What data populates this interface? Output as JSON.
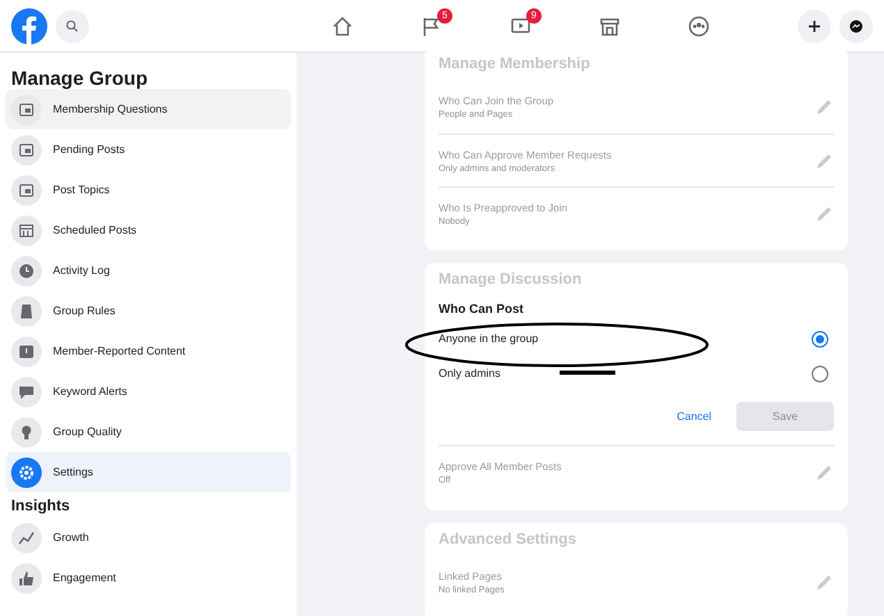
{
  "top_bar": {
    "nav": [
      {
        "kind": "home"
      },
      {
        "kind": "flag",
        "badge": "5"
      },
      {
        "kind": "video",
        "badge": "9"
      },
      {
        "kind": "store"
      },
      {
        "kind": "groups"
      }
    ]
  },
  "sidebar": {
    "sections": [
      {
        "title": "Manage Group",
        "items": [
          {
            "label": "Membership Questions",
            "selected": false,
            "hovered": true
          },
          {
            "label": "Pending Posts",
            "selected": false,
            "hovered": false
          },
          {
            "label": "Post Topics",
            "selected": false,
            "hovered": false
          },
          {
            "label": "Scheduled Posts",
            "selected": false,
            "hovered": false
          },
          {
            "label": "Activity Log",
            "selected": false,
            "hovered": false
          },
          {
            "label": "Group Rules",
            "selected": false,
            "hovered": false
          },
          {
            "label": "Member-Reported Content",
            "selected": false,
            "hovered": false
          },
          {
            "label": "Keyword Alerts",
            "selected": false,
            "hovered": false
          },
          {
            "label": "Group Quality",
            "selected": false,
            "hovered": false
          },
          {
            "label": "Settings",
            "selected": true,
            "hovered": false
          }
        ]
      },
      {
        "title": "Insights",
        "items": [
          {
            "label": "Growth",
            "selected": false,
            "hovered": false
          },
          {
            "label": "Engagement",
            "selected": false,
            "hovered": false
          }
        ]
      }
    ]
  },
  "cards": [
    {
      "title": "Manage Membership",
      "disabled": true,
      "rows": [
        {
          "label": "Who Can Join the Group",
          "value": "People and Pages"
        },
        {
          "label": "Who Can Approve Member Requests",
          "value": "Only admins and moderators"
        },
        {
          "label": "Who Is Preapproved to Join",
          "value": "Nobody"
        }
      ]
    },
    {
      "title": "Manage Discussion",
      "disabled": true,
      "editor": {
        "heading": "Who Can Post",
        "options": [
          {
            "label": "Anyone in the group",
            "selected": true
          },
          {
            "label": "Only admins",
            "selected": false
          }
        ],
        "cancel": "Cancel",
        "save": {
          "label": "Save",
          "disabled": true
        }
      },
      "rows": [
        {
          "label": "Approve All Member Posts",
          "value": "Off"
        }
      ]
    },
    {
      "title": "Advanced Settings",
      "disabled": true,
      "rows": [
        {
          "label": "Linked Pages",
          "value": "No linked Pages"
        }
      ]
    }
  ]
}
